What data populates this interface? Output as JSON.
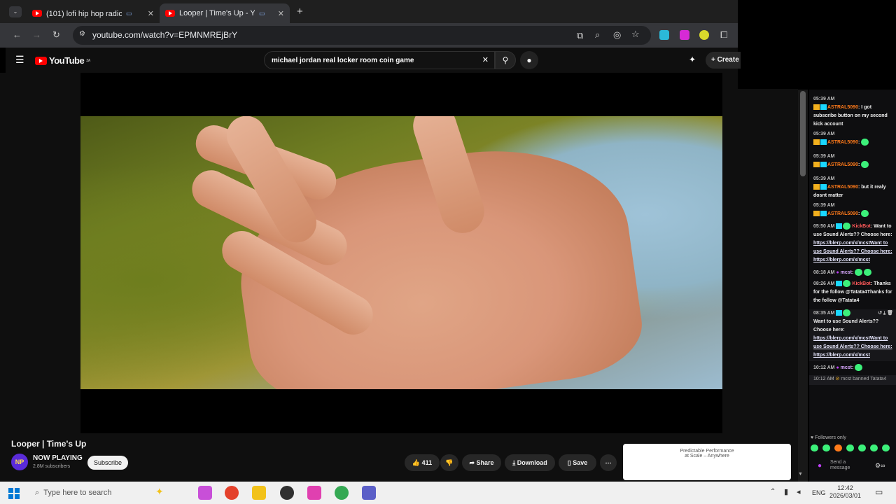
{
  "browser": {
    "tabs": [
      {
        "title": "(101) lofi hip hop radio 📚",
        "active": false
      },
      {
        "title": "Looper | Time's Up - YouTu",
        "active": true
      }
    ],
    "url": "youtube.com/watch?v=EPMNMREjBrY"
  },
  "youtube": {
    "logo": "YouTube",
    "region": "ZA",
    "search_query": "michael jordan real locker room coin game",
    "create_label": "Create"
  },
  "video": {
    "title": "Looper | Time's Up",
    "channel": "NOW PLAYING",
    "channel_avatar": "NP",
    "subscribers": "2.8M subscribers",
    "subscribe_label": "Subscribe",
    "likes": "411",
    "share_label": "Share",
    "download_label": "Download",
    "save_label": "Save",
    "watermark": "NP"
  },
  "ad": {
    "line1": "Predictable Performance",
    "line2": "at Scale – Anywhere"
  },
  "chat": {
    "messages": [
      {
        "time": "05:39 AM",
        "user": "ASTRAL5090",
        "text": "I got subscribe button on my second kick account"
      },
      {
        "time": "05:39 AM",
        "user": "ASTRAL5090",
        "text": ""
      },
      {
        "time": "05:39 AM",
        "user": "ASTRAL5090",
        "text": ""
      },
      {
        "time": "05:39 AM",
        "user": "ASTRAL5090",
        "text": "but it realy dosnt matter"
      },
      {
        "time": "05:39 AM",
        "user": "ASTRAL5090",
        "text": ""
      },
      {
        "time": "05:50 AM",
        "user": "KickBot",
        "text": "Want to use Sound Alerts?? Choose here:",
        "link": "https://blerp.com/x/mcstWant to use Sound Alerts?? Choose here:",
        "link2": "https://blerp.com/x/mcst"
      },
      {
        "time": "08:18 AM",
        "user": "mcst",
        "text": ""
      },
      {
        "time": "08:26 AM",
        "user": "KickBot",
        "text": "Thanks for the follow @Tatata4Thanks for the follow @Tatata4"
      },
      {
        "time": "08:35 AM",
        "user": "KickBot",
        "text": "Want to use Sound Alerts?? Choose here:",
        "link": "https://blerp.com/x/mcstWant to use Sound Alerts?? Choose here:",
        "link2": "https://blerp.com/x/mcst"
      },
      {
        "time": "10:12 AM",
        "user": "mcst",
        "text": ""
      },
      {
        "time": "10:12 AM",
        "user": "",
        "text": "mcst banned Tatata4"
      }
    ],
    "followers_only": "Followers only",
    "send_placeholder": "Send a message"
  },
  "taskbar": {
    "search_placeholder": "Type here to search",
    "language": "ENG",
    "time": "12:42",
    "date": "2026/03/01"
  }
}
